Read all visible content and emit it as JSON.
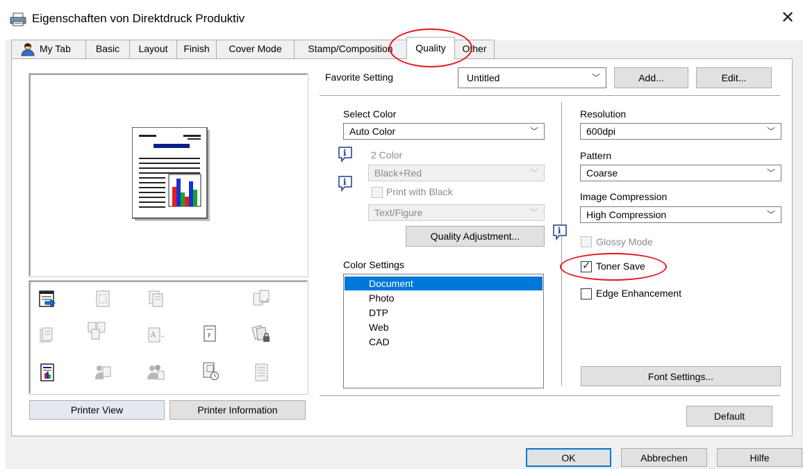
{
  "window": {
    "title": "Eigenschaften von Direktdruck Produktiv",
    "close_glyph": "✕"
  },
  "tabs": [
    {
      "label": "My Tab"
    },
    {
      "label": "Basic"
    },
    {
      "label": "Layout"
    },
    {
      "label": "Finish"
    },
    {
      "label": "Cover Mode"
    },
    {
      "label": "Stamp/Composition"
    },
    {
      "label": "Quality",
      "active": true
    },
    {
      "label": "Other"
    }
  ],
  "left_panel": {
    "printer_view_button": "Printer View",
    "printer_information_button": "Printer Information"
  },
  "favorite": {
    "label": "Favorite Setting",
    "value": "Untitled",
    "add_button": "Add...",
    "edit_button": "Edit..."
  },
  "select_color": {
    "label": "Select Color",
    "value": "Auto Color",
    "two_color_label": "2 Color",
    "two_color_value": "Black+Red",
    "print_with_black_label": "Print with Black",
    "print_with_black_checked": false,
    "text_figure_value": "Text/Figure",
    "quality_adjustment_button": "Quality Adjustment..."
  },
  "color_settings": {
    "label": "Color Settings",
    "items": [
      "Document",
      "Photo",
      "DTP",
      "Web",
      "CAD"
    ],
    "selected": "Document"
  },
  "resolution": {
    "label": "Resolution",
    "value": "600dpi"
  },
  "pattern": {
    "label": "Pattern",
    "value": "Coarse"
  },
  "image_compression": {
    "label": "Image Compression",
    "value": "High Compression"
  },
  "glossy_mode": {
    "label": "Glossy Mode",
    "checked": false,
    "enabled": false
  },
  "toner_save": {
    "label": "Toner Save",
    "checked": true
  },
  "edge_enhancement": {
    "label": "Edge Enhancement",
    "checked": false
  },
  "font_settings_button": "Font Settings...",
  "default_button": "Default",
  "footer": {
    "ok": "OK",
    "cancel": "Abbrechen",
    "help": "Hilfe"
  },
  "colors": {
    "selection": "#0078d7",
    "annotation_ring": "#e8131b",
    "dialog_background": "#f0f0f0"
  }
}
